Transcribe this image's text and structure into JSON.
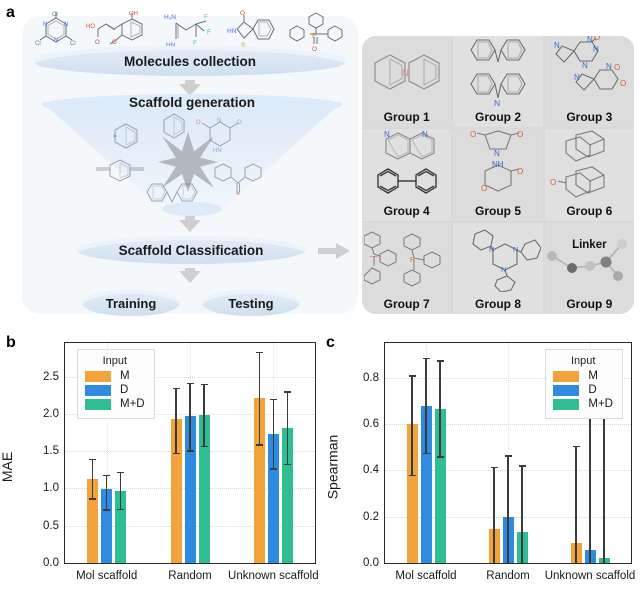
{
  "panels": {
    "a_letter": "a",
    "b_letter": "b",
    "c_letter": "c"
  },
  "flow": {
    "molecules_collection": "Molecules collection",
    "scaffold_generation": "Scaffold generation",
    "scaffold_classification": "Scaffold Classification",
    "training": "Training",
    "testing": "Testing"
  },
  "groups": [
    {
      "label": "Group 1"
    },
    {
      "label": "Group 2"
    },
    {
      "label": "Group 3"
    },
    {
      "label": "Group 4"
    },
    {
      "label": "Group 5"
    },
    {
      "label": "Group 6"
    },
    {
      "label": "Group 7"
    },
    {
      "label": "Group 8"
    },
    {
      "label": "Group 9",
      "annotation": "Linker"
    }
  ],
  "colors": {
    "M": "#F2A33C",
    "D": "#2E8BE0",
    "M_D": "#2FBE94",
    "error": "#3b3b3b",
    "axis": "#2b2b2b",
    "grid": "#d8d8d8",
    "panel_a_bg": "#f4f8fb",
    "group_grid_bg": "#d9d9d9"
  },
  "legend": {
    "title": "Input",
    "entries": [
      {
        "label": "M",
        "color_key": "M"
      },
      {
        "label": "D",
        "color_key": "D"
      },
      {
        "label": "M+D",
        "color_key": "M_D"
      }
    ]
  },
  "chart_data": [
    {
      "type": "bar",
      "panel": "b",
      "title": "",
      "xlabel": "",
      "ylabel": "MAE",
      "ylim": [
        0.0,
        2.95
      ],
      "yticks": [
        0.0,
        0.5,
        1.0,
        1.5,
        2.0,
        2.5
      ],
      "ytick_labels": [
        "0.0",
        "0.5",
        "1.0",
        "1.5",
        "2.0",
        "2.5"
      ],
      "grid": true,
      "legend_position": "upper left",
      "categories": [
        "Mol scaffold",
        "Random",
        "Unknown scaffold"
      ],
      "series": [
        {
          "name": "M",
          "color_key": "M",
          "values": [
            1.13,
            1.93,
            2.21
          ],
          "err_low": [
            0.87,
            1.48,
            1.59
          ],
          "err_high": [
            1.4,
            2.35,
            2.83
          ]
        },
        {
          "name": "D",
          "color_key": "D",
          "values": [
            0.99,
            1.97,
            1.73
          ],
          "err_low": [
            0.72,
            1.51,
            1.27
          ],
          "err_high": [
            1.18,
            2.42,
            2.2
          ]
        },
        {
          "name": "M+D",
          "color_key": "M_D",
          "values": [
            0.97,
            1.99,
            1.81
          ],
          "err_low": [
            0.73,
            1.57,
            1.33
          ],
          "err_high": [
            1.22,
            2.4,
            2.3
          ]
        }
      ]
    },
    {
      "type": "bar",
      "panel": "c",
      "title": "",
      "xlabel": "",
      "ylabel": "Spearman",
      "ylim": [
        0.0,
        0.95
      ],
      "yticks": [
        0.0,
        0.2,
        0.4,
        0.6,
        0.8
      ],
      "ytick_labels": [
        "0.0",
        "0.2",
        "0.4",
        "0.6",
        "0.8"
      ],
      "grid": true,
      "legend_position": "upper right",
      "categories": [
        "Mol scaffold",
        "Random",
        "Unknown scaffold"
      ],
      "series": [
        {
          "name": "M",
          "color_key": "M",
          "values": [
            0.6,
            0.145,
            0.088
          ],
          "err_low": [
            0.38,
            0.0,
            0.0
          ],
          "err_high": [
            0.81,
            0.415,
            0.505
          ]
        },
        {
          "name": "D",
          "color_key": "D",
          "values": [
            0.68,
            0.198,
            0.058
          ],
          "err_low": [
            0.475,
            0.0,
            0.0
          ],
          "err_high": [
            0.885,
            0.465,
            0.685
          ]
        },
        {
          "name": "M+D",
          "color_key": "M_D",
          "values": [
            0.665,
            0.132,
            0.021
          ],
          "err_low": [
            0.46,
            0.0,
            0.0
          ],
          "err_high": [
            0.875,
            0.422,
            0.63
          ]
        }
      ]
    }
  ]
}
